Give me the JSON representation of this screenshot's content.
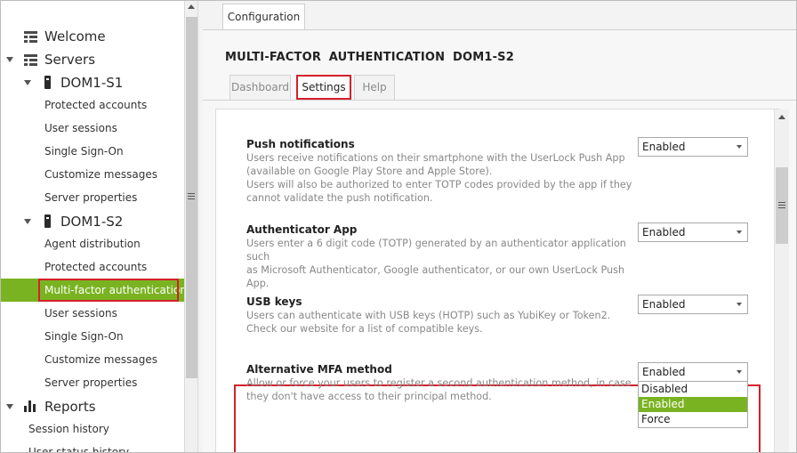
{
  "tree": {
    "welcome": "Welcome",
    "servers": "Servers",
    "server1": {
      "name": "DOM1-S1",
      "items": [
        "Protected accounts",
        "User sessions",
        "Single Sign-On",
        "Customize messages",
        "Server properties"
      ]
    },
    "server2": {
      "name": "DOM1-S2",
      "items": [
        "Agent distribution",
        "Protected accounts",
        "Multi-factor authentication",
        "User sessions",
        "Single Sign-On",
        "Customize messages",
        "Server properties"
      ],
      "selected": "Multi-factor authentication"
    },
    "reports": "Reports",
    "report_items": [
      "Session history",
      "User status history"
    ]
  },
  "main": {
    "window_tab": "Configuration",
    "title": "MULTI-FACTOR AUTHENTICATION   DOM1-S2",
    "tabs": [
      "Dashboard",
      "Settings",
      "Help"
    ],
    "active_tab": "Settings"
  },
  "settings": [
    {
      "name": "Push notifications",
      "desc": [
        "Users receive notifications on their smartphone with the UserLock Push App",
        "(available on Google Play Store and Apple Store).",
        "Users will also be authorized to enter TOTP codes provided by the app if they",
        "cannot validate the push notification."
      ],
      "value": "Enabled"
    },
    {
      "name": "Authenticator App",
      "desc": [
        "Users enter a 6 digit code (TOTP) generated by an authenticator application such",
        "as Microsoft Authenticator, Google authenticator, or our own UserLock Push",
        "App."
      ],
      "value": "Enabled"
    },
    {
      "name": "USB keys",
      "desc": [
        "Users can authenticate with USB keys (HOTP) such as YubiKey or Token2.",
        "Check our website for a list of compatible keys."
      ],
      "value": "Enabled"
    },
    {
      "name": "Alternative MFA method",
      "desc": [
        "Allow or force your users to register a second authentication method, in case",
        "they don't have access to their principal method."
      ],
      "value": "Enabled",
      "options": [
        "Disabled",
        "Enabled",
        "Force"
      ]
    }
  ],
  "colors": {
    "accent_green": "#7ab321",
    "highlight_red": "#d4202b"
  }
}
